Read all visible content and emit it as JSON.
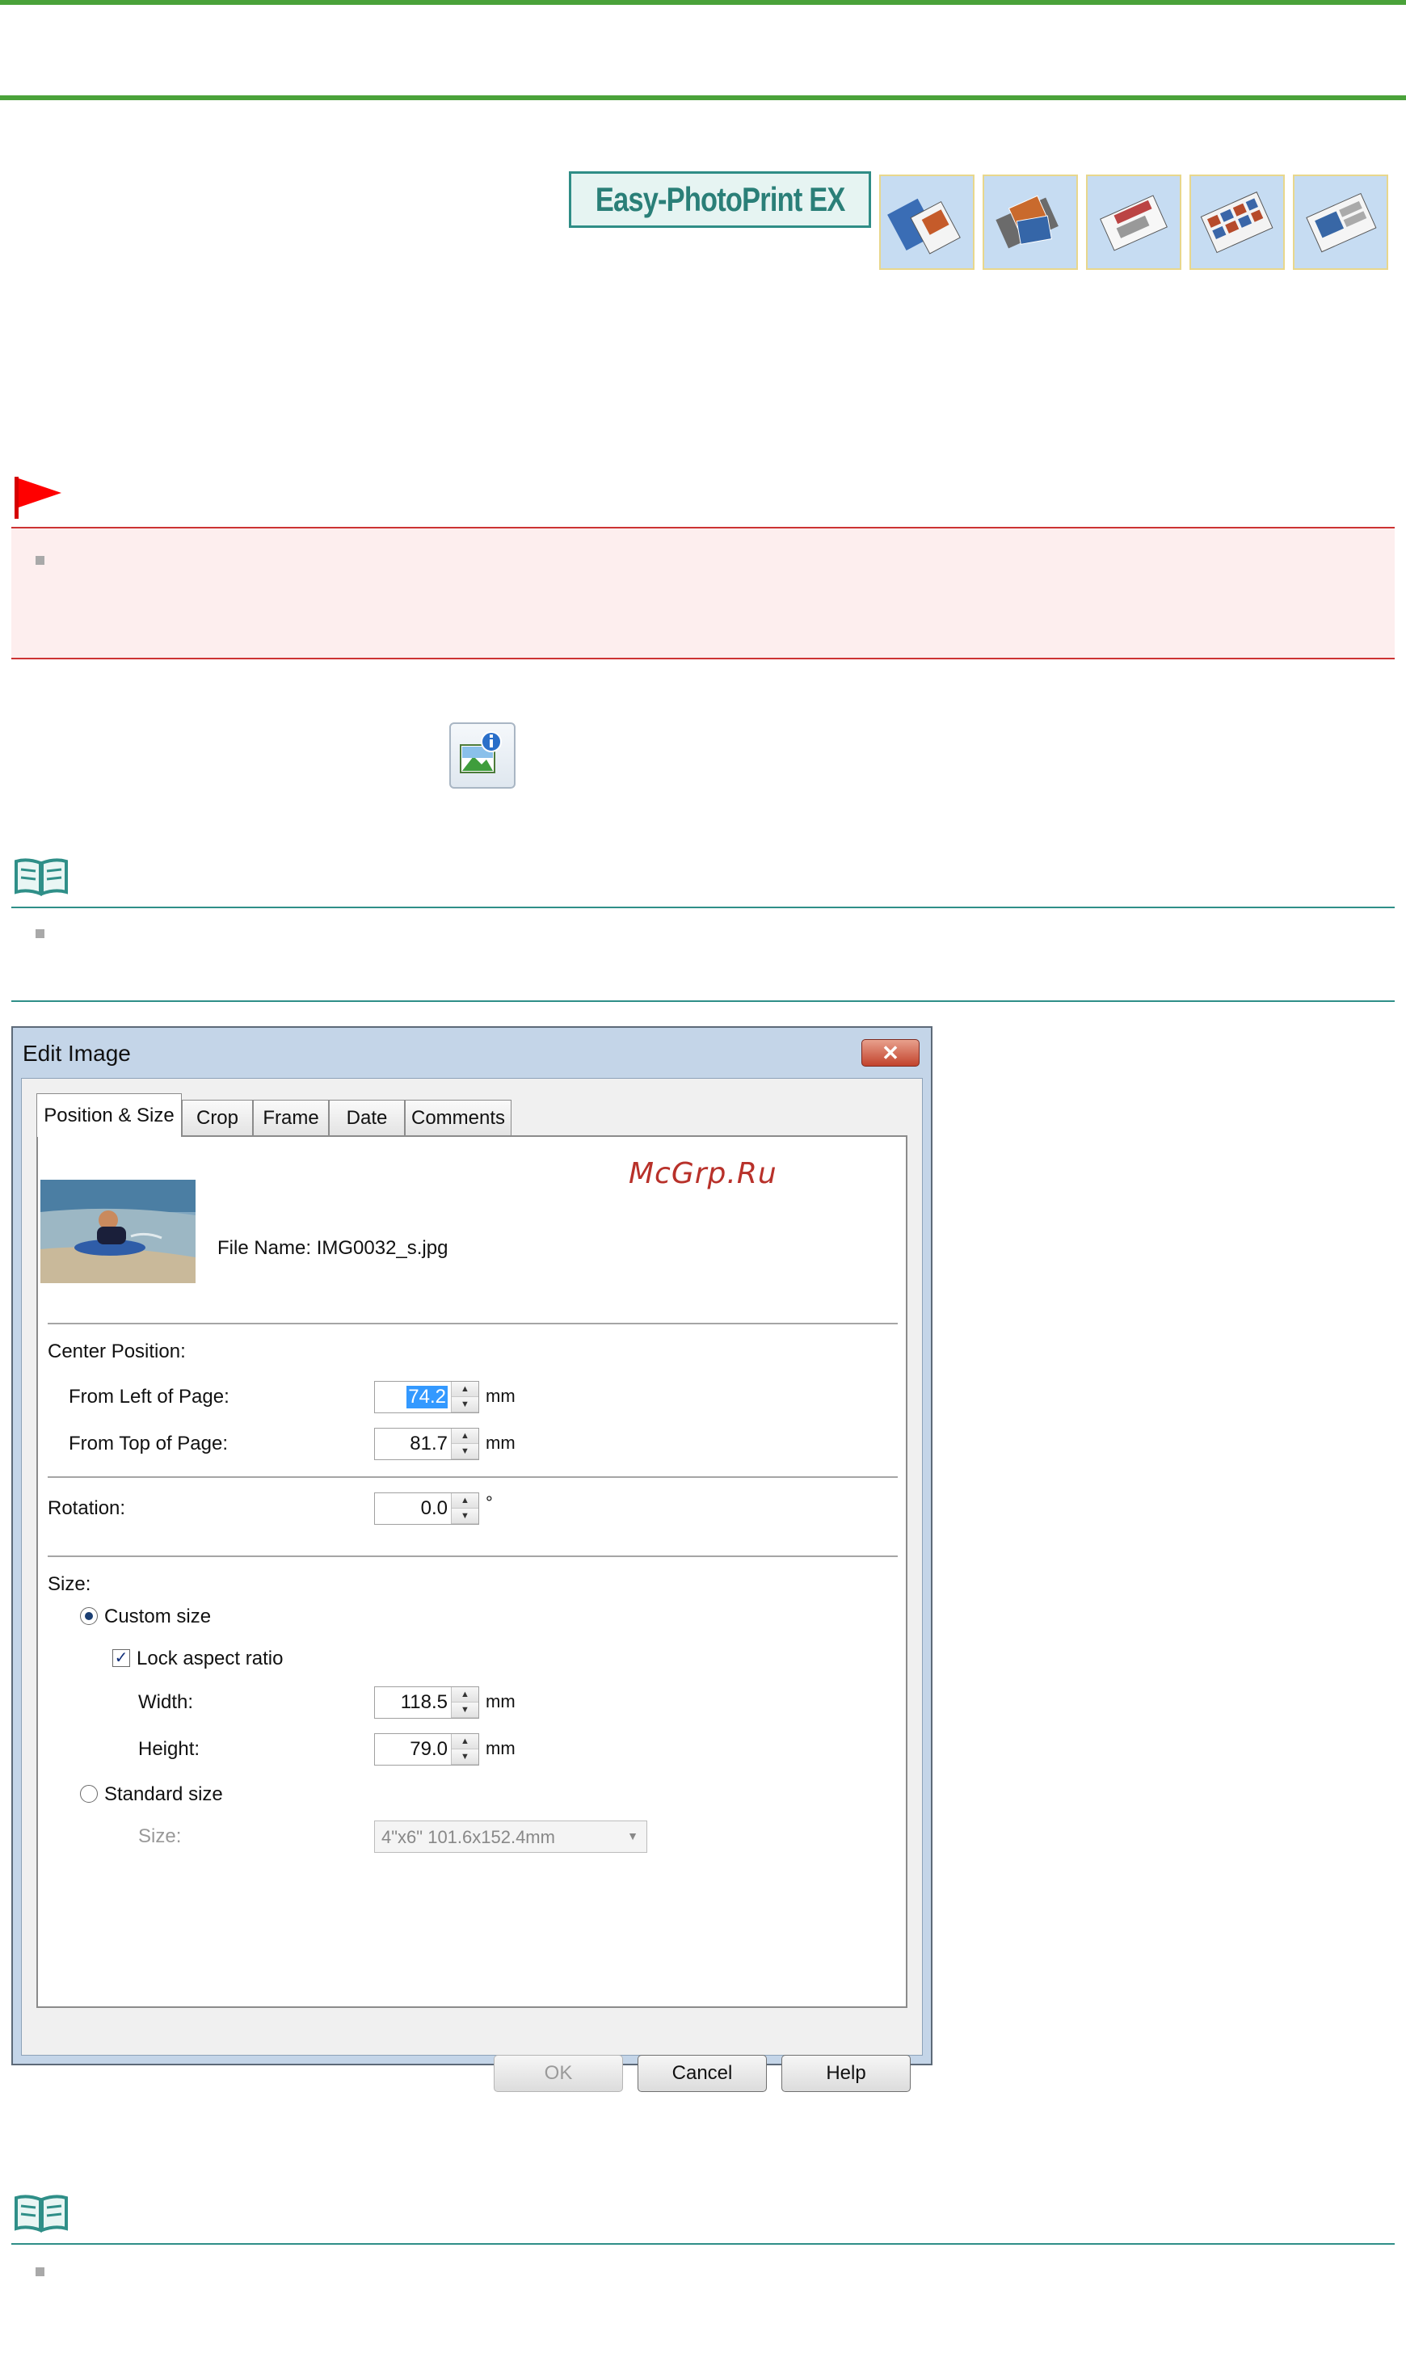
{
  "banner": {
    "product_logo": "Easy-PhotoPrint EX",
    "mode_icons": [
      "album-icon",
      "photo-print-icon",
      "calendar-icon",
      "stickers-icon",
      "layout-print-icon"
    ]
  },
  "watermark": "McGrp.Ru",
  "dialog": {
    "title": "Edit Image",
    "close_label": "✕",
    "tabs": [
      {
        "label": "Position & Size",
        "active": true
      },
      {
        "label": "Crop"
      },
      {
        "label": "Frame"
      },
      {
        "label": "Date"
      },
      {
        "label": "Comments"
      }
    ],
    "file_name_label": "File Name: IMG0032_s.jpg",
    "center_position": {
      "heading": "Center Position:",
      "from_left": {
        "label": "From Left of Page:",
        "value": "74.2",
        "unit": "mm"
      },
      "from_top": {
        "label": "From Top of Page:",
        "value": "81.7",
        "unit": "mm"
      }
    },
    "rotation": {
      "label": "Rotation:",
      "value": "0.0",
      "unit": "°"
    },
    "size": {
      "heading": "Size:",
      "custom_size": "Custom size",
      "lock_aspect": "Lock aspect ratio",
      "width": {
        "label": "Width:",
        "value": "118.5",
        "unit": "mm"
      },
      "height": {
        "label": "Height:",
        "value": "79.0",
        "unit": "mm"
      },
      "standard_size": "Standard size",
      "size_label": "Size:",
      "size_value": "4\"x6\" 101.6x152.4mm"
    },
    "buttons": {
      "ok": "OK",
      "cancel": "Cancel",
      "help": "Help"
    }
  }
}
